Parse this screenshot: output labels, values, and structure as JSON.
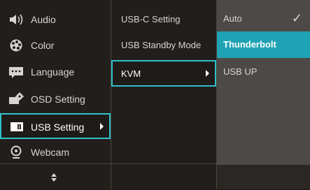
{
  "main_menu": {
    "items": [
      {
        "label": "Audio",
        "icon": "speaker-icon"
      },
      {
        "label": "Color",
        "icon": "palette-icon"
      },
      {
        "label": "Language",
        "icon": "speech-bubble-icon"
      },
      {
        "label": "OSD Setting",
        "icon": "monitor-gear-icon"
      },
      {
        "label": "USB Setting",
        "icon": "usb-icon",
        "selected": true
      },
      {
        "label": "Webcam",
        "icon": "webcam-icon"
      }
    ],
    "footer_icon": "up-down-icon"
  },
  "sub_menu": {
    "items": [
      {
        "label": "USB-C Setting"
      },
      {
        "label": "USB Standby Mode"
      },
      {
        "label": "KVM",
        "selected": true
      }
    ]
  },
  "options": {
    "items": [
      {
        "label": "Auto",
        "checked": true
      },
      {
        "label": "Thunderbolt",
        "highlighted": true
      },
      {
        "label": "USB UP"
      }
    ]
  },
  "colors": {
    "accent": "#2ec2c9",
    "highlight": "#1fa3b4"
  }
}
